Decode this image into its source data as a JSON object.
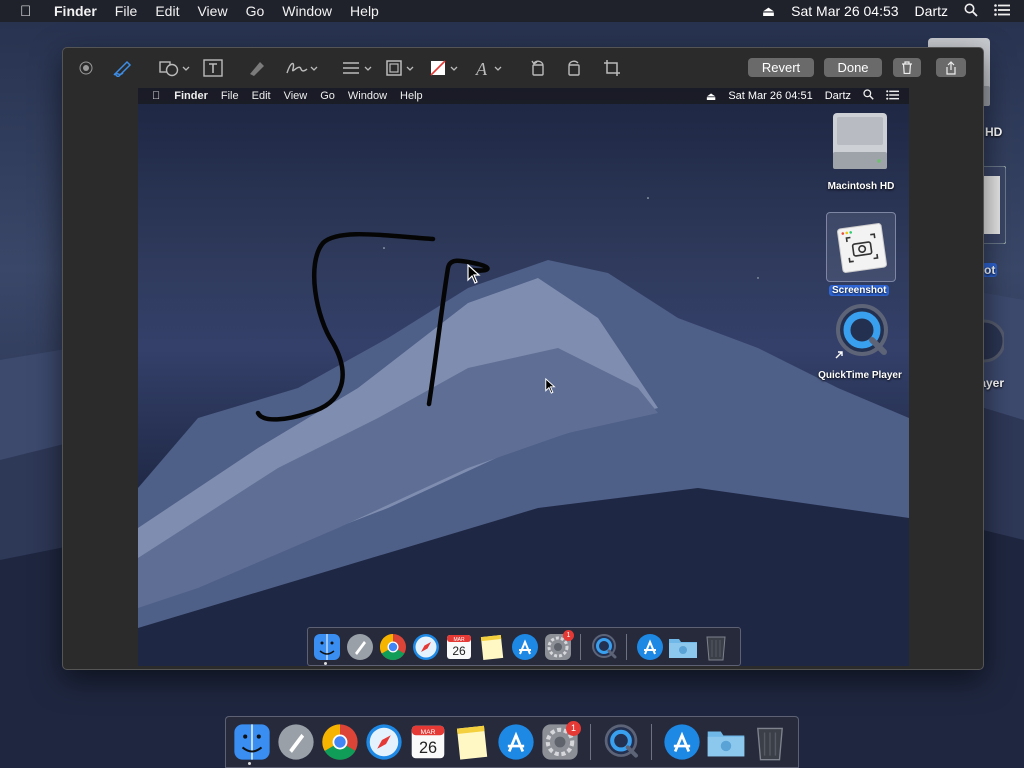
{
  "menubar": {
    "items": [
      "Finder",
      "File",
      "Edit",
      "View",
      "Go",
      "Window",
      "Help"
    ],
    "datetime": "Sat Mar 26  04:53",
    "user": "Dartz"
  },
  "desktop": {
    "icon_labels": [
      "HD",
      "ot",
      "layer"
    ]
  },
  "toolbar": {
    "revert_label": "Revert",
    "done_label": "Done"
  },
  "screenshot": {
    "menubar": {
      "items": [
        "Finder",
        "File",
        "Edit",
        "View",
        "Go",
        "Window",
        "Help"
      ],
      "datetime": "Sat Mar 26  04:51",
      "user": "Dartz"
    },
    "desktop_icons": [
      {
        "label": "Macintosh HD",
        "icon": "hard-drive-icon"
      },
      {
        "label": "Screenshot",
        "icon": "screenshot-file-icon"
      },
      {
        "label": "QuickTime Player",
        "icon": "quicktime-icon"
      }
    ]
  },
  "dock": {
    "apps": [
      {
        "name": "finder",
        "icon": "finder-icon"
      },
      {
        "name": "launchpad",
        "icon": "launchpad-icon"
      },
      {
        "name": "chrome",
        "icon": "chrome-icon"
      },
      {
        "name": "safari",
        "icon": "safari-icon"
      },
      {
        "name": "calendar",
        "icon": "calendar-icon"
      },
      {
        "name": "notes",
        "icon": "notes-icon"
      },
      {
        "name": "app-store",
        "icon": "app-store-icon"
      },
      {
        "name": "system-preferences",
        "icon": "system-preferences-icon"
      },
      {
        "name": "quicktime",
        "icon": "quicktime-icon"
      },
      {
        "name": "applications-folder",
        "icon": "app-store-icon"
      },
      {
        "name": "downloads-folder",
        "icon": "folder-icon"
      },
      {
        "name": "trash",
        "icon": "trash-icon"
      }
    ],
    "calendar_month": "MAR",
    "calendar_day": "26",
    "badge_count": "1"
  },
  "colors": {
    "selection": "#2f66d6",
    "badge": "#e53935"
  }
}
